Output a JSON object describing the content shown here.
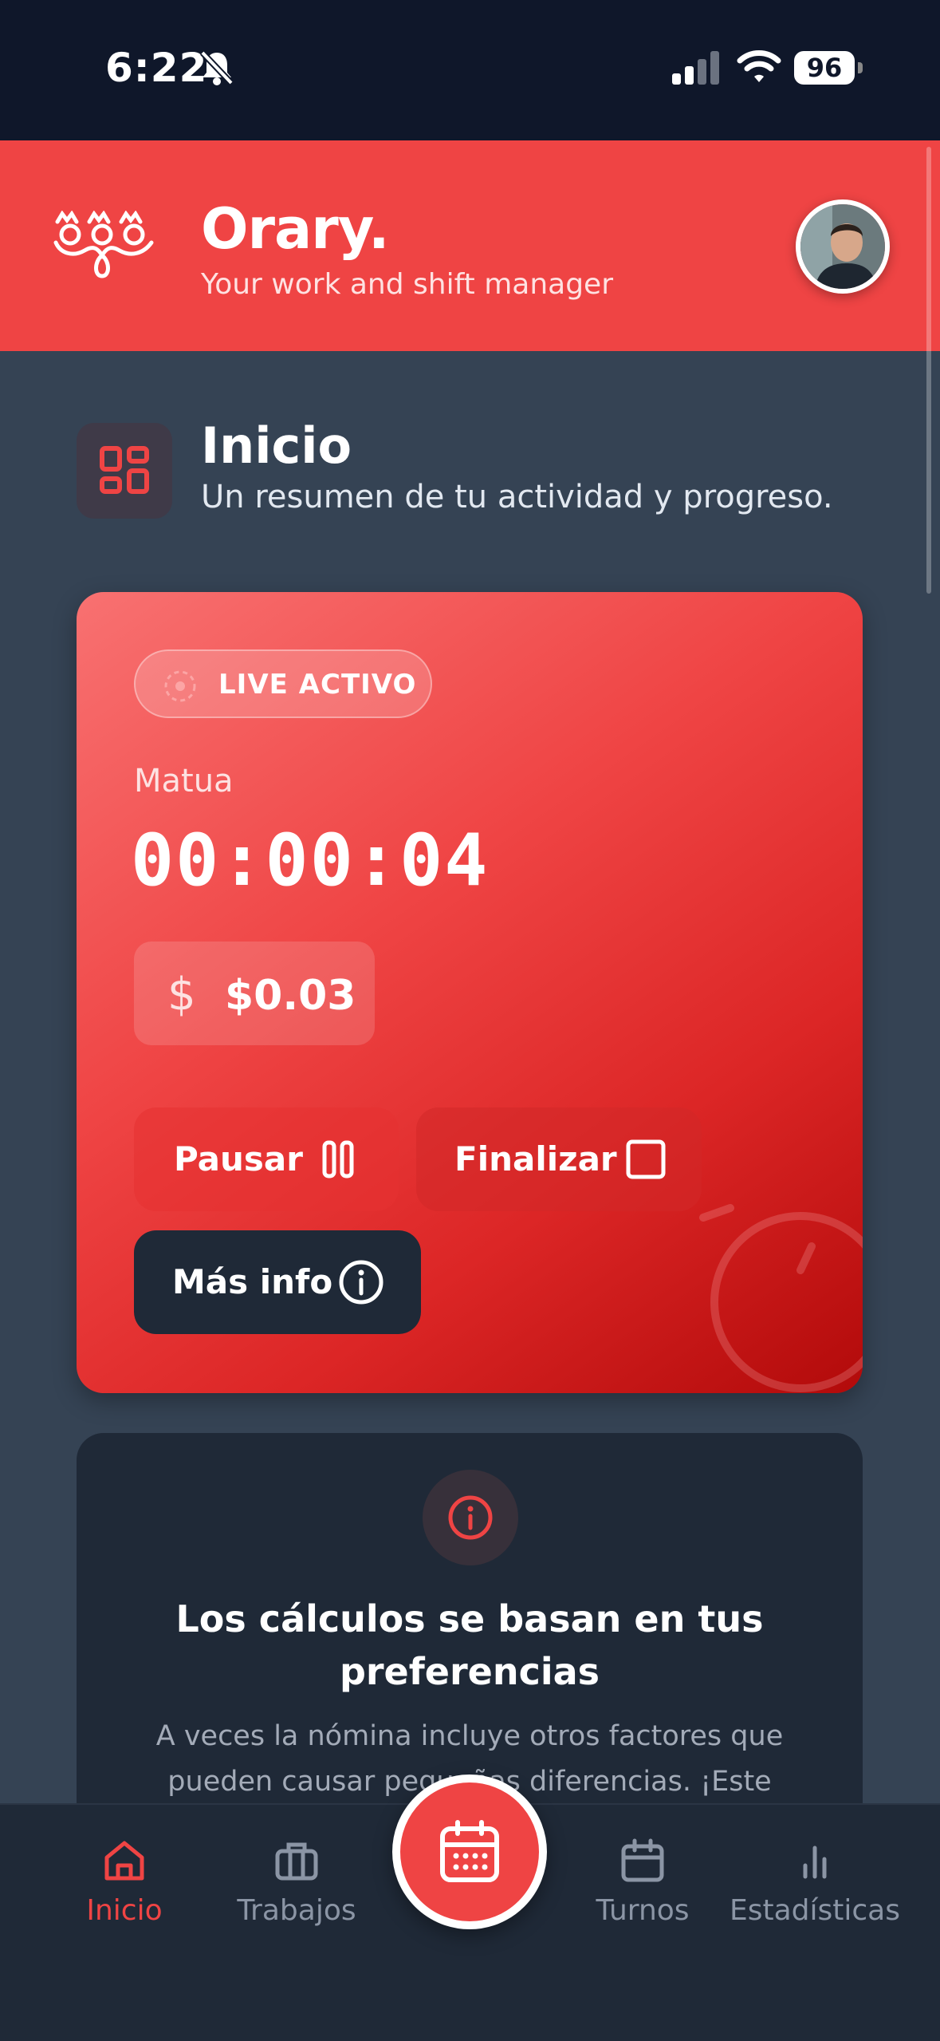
{
  "status_bar": {
    "time": "6:22",
    "battery": "96"
  },
  "header": {
    "brand": "Orary.",
    "tagline": "Your work and shift manager"
  },
  "page": {
    "title": "Inicio",
    "subtitle": "Un resumen de tu actividad y progreso."
  },
  "live_card": {
    "badge": "LIVE ACTIVO",
    "job_name": "Matua",
    "timer": "00:00:04",
    "earnings_sign": "$",
    "earnings": "$0.03",
    "pause_label": "Pausar",
    "finish_label": "Finalizar",
    "info_label": "Más info"
  },
  "info_card": {
    "title": "Los cálculos se basan en tus preferencias",
    "text": "A veces la nómina incluye otros factores que pueden causar pequeñas diferencias. ¡Este"
  },
  "nav": {
    "items": [
      {
        "label": "Inicio",
        "icon": "home-icon"
      },
      {
        "label": "Trabajos",
        "icon": "briefcase-icon"
      },
      {
        "label": "Turnos",
        "icon": "calendar-icon"
      },
      {
        "label": "Estadísticas",
        "icon": "bar-chart-icon"
      }
    ],
    "fab_icon": "calendar-icon"
  },
  "colors": {
    "accent": "#ef4444",
    "background": "#354354",
    "surface": "#1f2937",
    "status_bar": "#0f172a"
  }
}
